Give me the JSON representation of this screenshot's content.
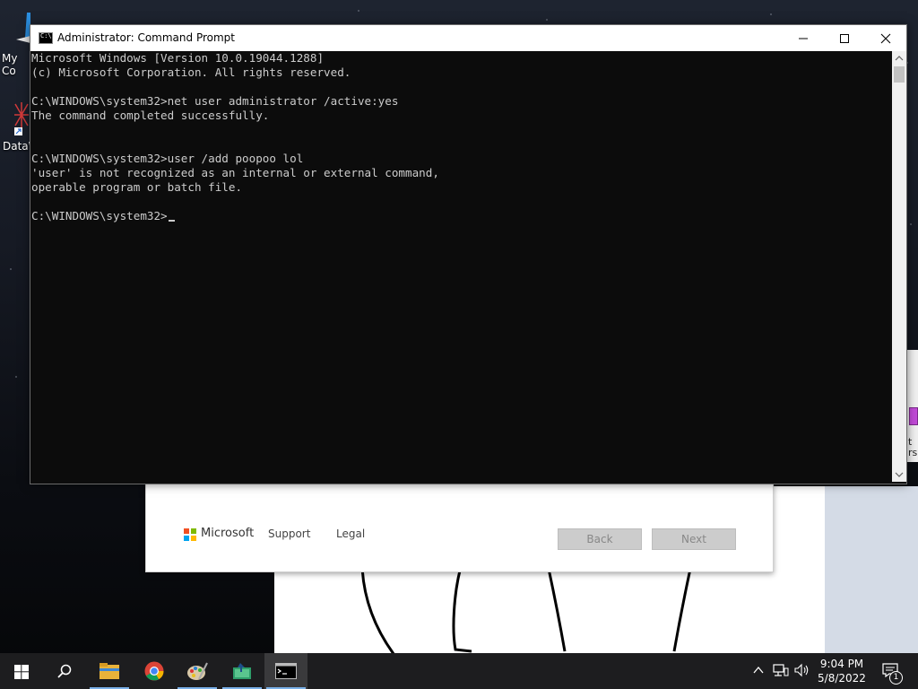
{
  "desktop": {
    "icons": [
      {
        "label": "My Co",
        "icon": "my-computer-icon"
      },
      {
        "label": "DataW",
        "icon": "datawrapper-icon"
      }
    ],
    "right_window_text": [
      "t",
      "rs"
    ]
  },
  "cmd": {
    "title": "Administrator: Command Prompt",
    "icon_glyph": "C:\\",
    "lines": [
      "Microsoft Windows [Version 10.0.19044.1288]",
      "(c) Microsoft Corporation. All rights reserved.",
      "",
      "C:\\WINDOWS\\system32>net user administrator /active:yes",
      "The command completed successfully.",
      "",
      "",
      "C:\\WINDOWS\\system32>user /add poopoo lol",
      "'user' is not recognized as an internal or external command,",
      "operable program or batch file.",
      "",
      "C:\\WINDOWS\\system32>"
    ]
  },
  "setup": {
    "brand": "Microsoft",
    "support": "Support",
    "legal": "Legal",
    "back": "Back",
    "next": "Next"
  },
  "taskbar": {
    "items": [
      "start-icon",
      "search-icon",
      "file-explorer-icon",
      "chrome-icon",
      "paint-icon",
      "app-icon",
      "command-prompt-icon"
    ],
    "time": "9:04 PM",
    "date": "5/8/2022",
    "notification_count": "1"
  },
  "colors": {
    "console_bg": "#0c0c0c",
    "console_fg": "#cccccc",
    "taskbar_bg": "#1d1d1f",
    "accent": "#7ab0e8"
  }
}
